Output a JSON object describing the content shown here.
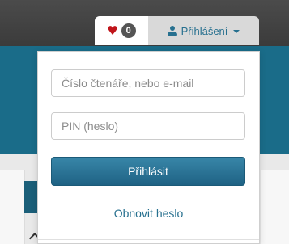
{
  "header": {
    "favorites": {
      "icon": "heart-icon",
      "count": "0",
      "heart_color": "#c0151b"
    },
    "login_toggle": {
      "label": "Přihlášení",
      "icon": "user-icon",
      "caret": "caret-down-icon"
    }
  },
  "login_form": {
    "username": {
      "placeholder": "Číslo čtenáře, nebo e-mail",
      "value": ""
    },
    "pin": {
      "placeholder": "PIN (heslo)",
      "value": ""
    },
    "submit_label": "Přihlásit",
    "reset_label": "Obnovit heslo"
  },
  "colors": {
    "topbar": "#444444",
    "accent": "#1a6c89",
    "button": "#2a7497",
    "link": "#27708f"
  }
}
